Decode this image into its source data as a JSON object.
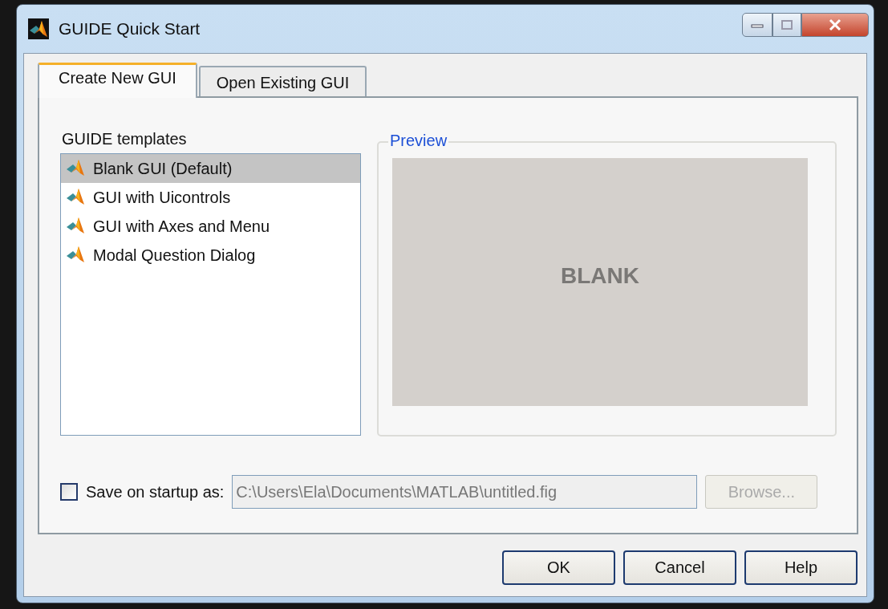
{
  "window": {
    "title": "GUIDE Quick Start"
  },
  "tabs": [
    {
      "label": "Create New GUI",
      "selected": true
    },
    {
      "label": "Open Existing GUI",
      "selected": false
    }
  ],
  "templates": {
    "label": "GUIDE templates",
    "items": [
      {
        "label": "Blank GUI (Default)",
        "selected": true
      },
      {
        "label": "GUI with Uicontrols",
        "selected": false
      },
      {
        "label": "GUI with Axes and Menu",
        "selected": false
      },
      {
        "label": "Modal Question Dialog",
        "selected": false
      }
    ]
  },
  "preview": {
    "label": "Preview",
    "text": "BLANK"
  },
  "save_on_startup": {
    "label": "Save on startup as:",
    "checked": false,
    "value": "C:\\Users\\Ela\\Documents\\MATLAB\\untitled.fig",
    "disabled": true,
    "browse": {
      "label": "Browse...",
      "disabled": true
    }
  },
  "buttons": [
    "OK",
    "Cancel",
    "Help"
  ]
}
